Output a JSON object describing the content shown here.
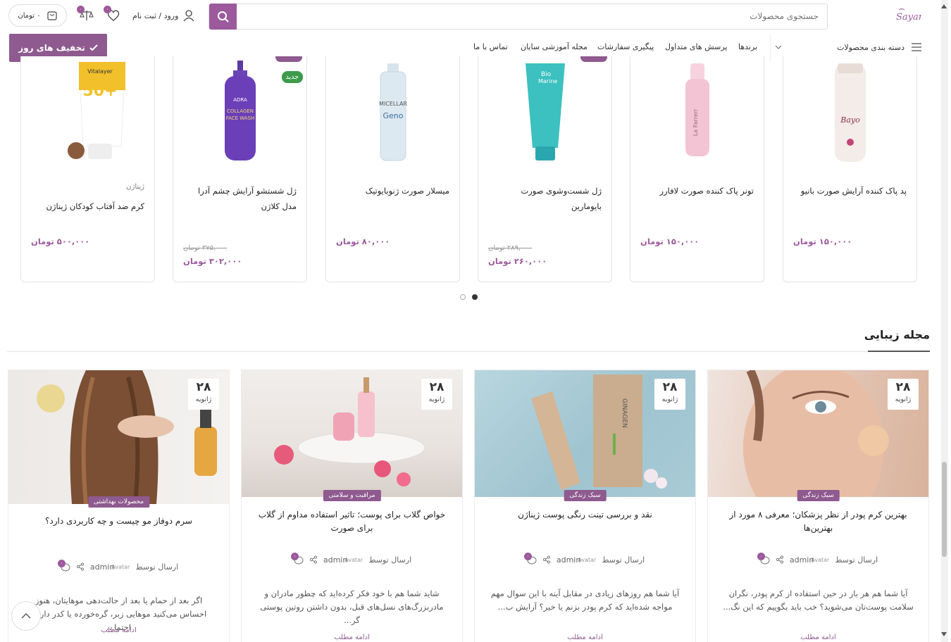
{
  "header": {
    "logo_text": "Sayan",
    "search_placeholder": "جستجوی محصولات",
    "login_label": "ورود / ثبت نام",
    "cart_total": "۰ تومان",
    "wishlist_count": "۰",
    "compare_count": "۰"
  },
  "nav": {
    "categories_label": "دسته بندی محصولات",
    "items": [
      "برندها",
      "پرسش های متداول",
      "پیگیری سفارشات",
      "مجله آموزشی سایان",
      "تماس با ما"
    ],
    "deal_button": "تخفیف های روز"
  },
  "products": [
    {
      "name": "پد پاک کننده آرایش صورت بانیو",
      "price": "۱۵۰,۰۰۰ تومان",
      "old_price": "",
      "brand": "",
      "tag": ""
    },
    {
      "name": "تونر پاک کننده صورت لافارر",
      "price": "۱۵۰,۰۰۰ تومان",
      "old_price": "",
      "brand": "",
      "tag": ""
    },
    {
      "name": "ژل شست‌وشوی صورت بایومارین",
      "price": "۲۶۰,۰۰۰ تومان",
      "old_price": "۲۸۹,۰۰۰ تومان",
      "brand": "",
      "tag": ""
    },
    {
      "name": "میسلار صورت ژنوبایوتیک",
      "price": "۸۰,۰۰۰ تومان",
      "old_price": "",
      "brand": "",
      "tag": ""
    },
    {
      "name": "ژل شستشو آرایش چشم آدرا مدل کلاژن",
      "price": "۳۰۲,۰۰۰ تومان",
      "old_price": "۳۷۵,۰۰۰ تومان",
      "brand": "",
      "tag": "جدید"
    },
    {
      "name": "کرم ضد آفتاب کودکان ژیناژن",
      "price": "۵۰۰,۰۰۰ تومان",
      "old_price": "",
      "brand": "ژیناژن",
      "tag": ""
    }
  ],
  "magazine": {
    "title": "مجله زیبایی",
    "articles": [
      {
        "day": "۲۸",
        "month": "ژانویه",
        "category": "سبک زندگی",
        "title": "بهترین کرم پودر از نظر پزشکان؛ معرفی ۸ مورد از بهترین‌ها",
        "author_prefix": "ارسال توسط",
        "author": "admin",
        "avatar_alt": "Avatar",
        "excerpt": "آیا شما هم هر بار در حین استفاده از کرم پودر، نگران سلامت پوست‌تان می‌شوید؟ خب باید بگوییم که این نگ...",
        "more": "ادامه مطلب",
        "comments": "۰"
      },
      {
        "day": "۲۸",
        "month": "ژانویه",
        "category": "سبک زندگی",
        "title": "نقد و بررسی تینت رنگی پوست ژیناژن",
        "author_prefix": "ارسال توسط",
        "author": "admin",
        "avatar_alt": "Avatar",
        "excerpt": "آیا شما هم روزهای زیادی در مقابل آینه با این سوال مهم مواجه شده‌اید که کرم پودر بزنم یا خیر؟ آرایش ب...",
        "more": "ادامه مطلب",
        "comments": "۰"
      },
      {
        "day": "۲۸",
        "month": "ژانویه",
        "category": "مراقبت و سلامتی",
        "title": "خواص گلاب برای پوست؛ تاثیر استفاده مداوم از گلاب برای صورت",
        "author_prefix": "ارسال توسط",
        "author": "admin",
        "avatar_alt": "Avatar",
        "excerpt": "شاید شما هم با خود فکر کرده‌اید که چطور مادران و مادربزرگ‌های نسل‌های قبل، بدون داشتن روتین پوستی گر...",
        "more": "ادامه مطلب",
        "comments": "۰"
      },
      {
        "day": "۲۸",
        "month": "ژانویه",
        "category": "محصولات بهداشتی",
        "title": "سرم دوفاز مو چیست و چه کاربردی دارد؟",
        "author_prefix": "ارسال توسط",
        "author": "admin",
        "avatar_alt": "Avatar",
        "excerpt": "اگر بعد از حمام یا بعد از حالت‌دهی موهایتان، هنوز احساس می‌کنید موهایی زبر، گره‌خورده یا کدر دارید، احتما...",
        "more": "ادامه مطلب",
        "comments": "۰"
      }
    ]
  },
  "colors": {
    "accent": "#9c5a9c",
    "new_badge": "#3d9a4a"
  }
}
